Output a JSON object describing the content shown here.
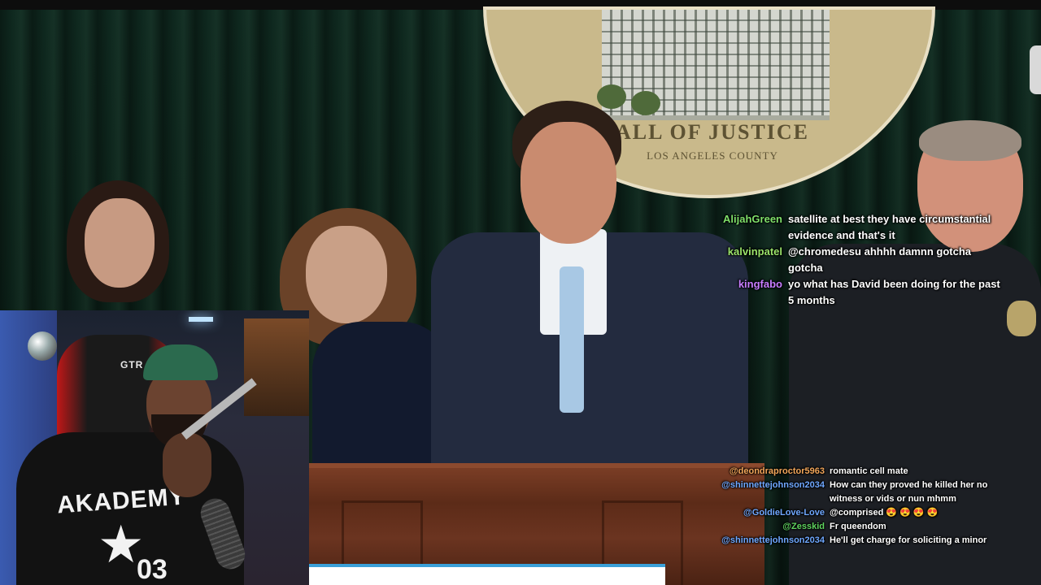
{
  "seal": {
    "title": "ALL OF JUSTICE",
    "subtitle": "LOS ANGELES COUNTY"
  },
  "webcam": {
    "chair_label": "GTR",
    "jersey_text": "AKADEMY",
    "jersey_number": "03"
  },
  "chat_top": [
    {
      "user": "AlijahGreen",
      "color": "#7fe06a",
      "message": "satellite at best they have circumstantial evidence and that's it"
    },
    {
      "user": "kalvinpatel",
      "color": "#9be36a",
      "message": "@chromedesu ahhhh damnn gotcha gotcha"
    },
    {
      "user": "kingfabo",
      "color": "#c77dff",
      "message": "yo what has David been doing for the past 5 months"
    }
  ],
  "chat_bottom": [
    {
      "user": "@deondraproctor5963",
      "color": "#f2a65a",
      "message": "romantic cell mate"
    },
    {
      "user": "@shinnettejohnson2034",
      "color": "#6fa8ff",
      "message": "How can they proved he killed her no witness or vids or nun mhmm"
    },
    {
      "user": "@GoldieLove-Love",
      "color": "#6fa8ff",
      "message": "@comprised 😍 😍 😍 😍"
    },
    {
      "user": "@Zesskid",
      "color": "#5fd35f",
      "message": "Fr queendom"
    },
    {
      "user": "@shinnettejohnson2034",
      "color": "#6fa8ff",
      "message": "He'll get charge for soliciting a minor"
    }
  ]
}
